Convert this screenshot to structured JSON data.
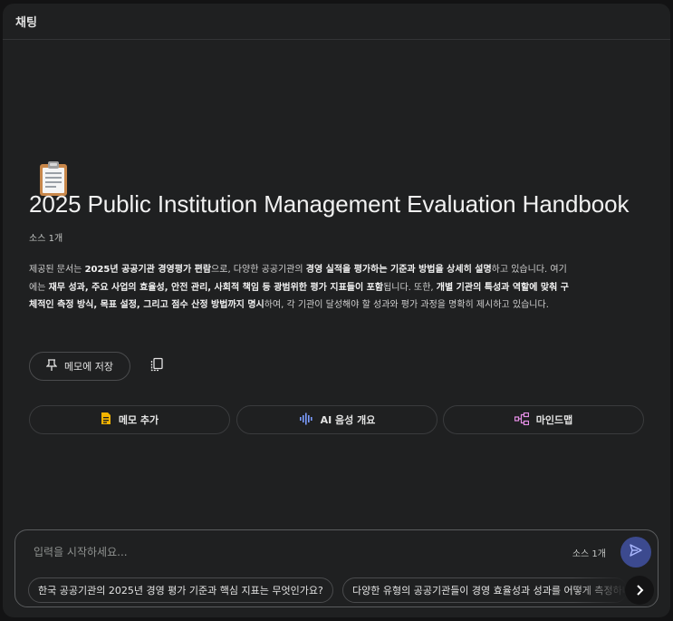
{
  "header": {
    "title": "채팅"
  },
  "notebook": {
    "emoji_icon": "clipboard-icon",
    "title": "2025 Public Institution Management Evaluation Handbook",
    "source_count": "소스 1개",
    "summary": {
      "p1": "제공된 문서는 ",
      "b1": "2025년 공공기관 경영평가 편람",
      "p2": "으로, 다양한 공공기관의 ",
      "b2": "경영 실적을 평가하는 기준과 방법을 상세히 설명",
      "p3": "하고 있습니다. 여기에는 ",
      "b3": "재무 성과, 주요 사업의 효율성, 안전 관리, 사회적 책임 등 광범위한 평가 지표들이 포함",
      "p4": "됩니다. 또한, ",
      "b4": "개별 기관의 특성과 역할에 맞춰 구체적인 측정 방식, 목표 설정, 그리고 점수 산정 방법까지 명시",
      "p5": "하여, 각 기관이 달성해야 할 성과와 평가 과정을 명확히 제시하고 있습니다."
    }
  },
  "actions": {
    "save_to_memo": "메모에 저장",
    "add_memo": "메모 추가",
    "ai_audio_overview": "AI 음성 개요",
    "mind_map": "마인드맵"
  },
  "input": {
    "placeholder": "입력을 시작하세요...",
    "source_count": "소스 1개"
  },
  "suggestions": [
    "한국 공공기관의 2025년 경영 평가 기준과 핵심 지표는 무엇인가요?",
    "다양한 유형의 공공기관들이 경영 효율성과 성과를 어떻게 측정하나요?"
  ],
  "colors": {
    "background": "#1f2021",
    "send_button": "#3c4a8f",
    "memo_icon": "#f4b400",
    "audio_icon": "#7b9cff",
    "mindmap_icon": "#e58fe6"
  }
}
